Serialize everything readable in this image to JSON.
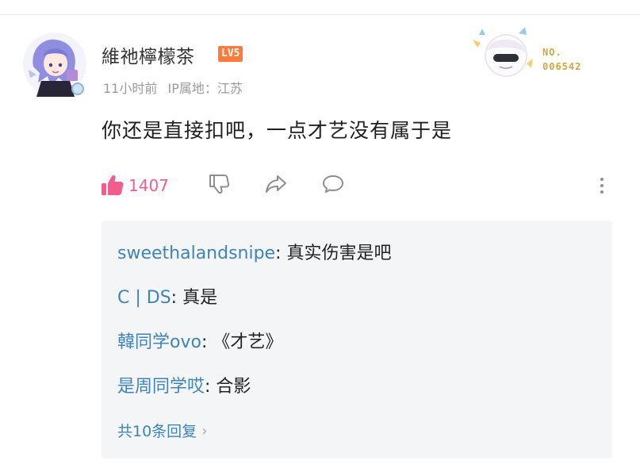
{
  "comment": {
    "username": "維祂檸檬茶",
    "level": "LV5",
    "time": "11小时前",
    "ip_location": "IP属地：江苏",
    "text": "你还是直接扣吧，一点才艺没有属于是",
    "fan_badge": {
      "no_label": "NO.",
      "number": "006542"
    },
    "likes": "1407"
  },
  "icons": {
    "like": "thumbs-up-icon",
    "dislike": "thumbs-down-icon",
    "share": "share-arrow-icon",
    "reply": "speech-bubble-icon",
    "more": "more-vertical-icon"
  },
  "colors": {
    "like_pink": "#f25d8e",
    "reply_author_blue": "#3e84b8",
    "level_orange": "#ff7a3d",
    "replies_bg": "#f4f5f7"
  },
  "replies": [
    {
      "author": "sweethalandsnipe",
      "sep": ": ",
      "text": "真实伤害是吧"
    },
    {
      "author": "C | DS",
      "sep": ": ",
      "text": "真是"
    },
    {
      "author": "韓同学ovo",
      "sep": ": ",
      "text": "《才艺》"
    },
    {
      "author": "是周同学哎",
      "sep": ": ",
      "text": "合影"
    }
  ],
  "more_replies_label": "共10条回复"
}
